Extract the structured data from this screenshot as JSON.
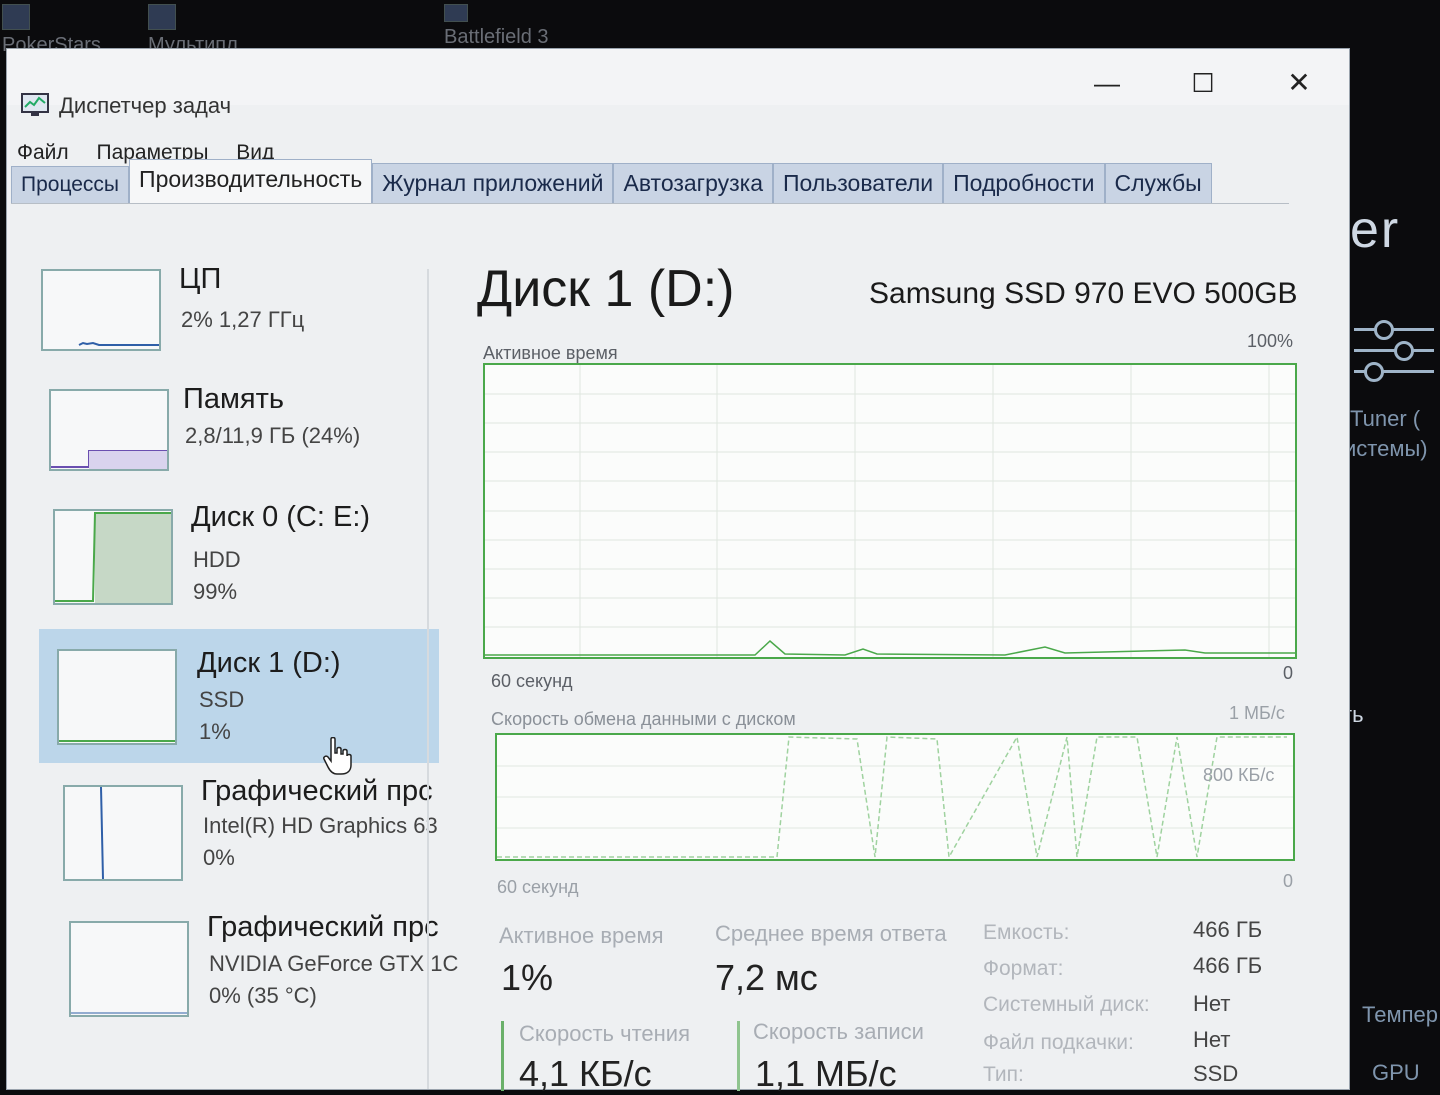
{
  "desktop": {
    "icons": [
      "PokerStars...",
      "Мультипл...",
      "Battlefield 3"
    ],
    "right_texts": [
      "Tuner (",
      "истемы)",
      "ть",
      "Темпер",
      "GPU"
    ],
    "logo": "er"
  },
  "window": {
    "title": "Диспетчер задач",
    "controls": {
      "minimize": "—",
      "maximize": "☐",
      "close": "✕"
    },
    "menu": [
      "Файл",
      "Параметры",
      "Вид"
    ],
    "tabs": [
      "Процессы",
      "Производительность",
      "Журнал приложений",
      "Автозагрузка",
      "Пользователи",
      "Подробности",
      "Службы"
    ],
    "active_tab": "Производительность"
  },
  "sidebar": {
    "items": [
      {
        "name": "ЦП",
        "line1": "2% 1,27 ГГц",
        "line2": ""
      },
      {
        "name": "Память",
        "line1": "2,8/11,9 ГБ (24%)",
        "line2": ""
      },
      {
        "name": "Диск 0 (C: E:)",
        "line1": "HDD",
        "line2": "99%"
      },
      {
        "name": "Диск 1 (D:)",
        "line1": "SSD",
        "line2": "1%"
      },
      {
        "name": "Графический прс",
        "line1": "Intel(R) HD Graphics 63",
        "line2": "0%"
      },
      {
        "name": "Графический прс",
        "line1": "NVIDIA GeForce GTX 1C",
        "line2": "0% (35 °C)"
      }
    ],
    "selected_index": 3
  },
  "detail": {
    "title": "Диск 1 (D:)",
    "model": "Samsung SSD 970 EVO 500GB",
    "graph1": {
      "label": "Активное время",
      "max": "100%",
      "time": "60 секунд",
      "min": "0"
    },
    "graph2": {
      "label": "Скорость обмена данными с диском",
      "max": "1 МБ/с",
      "mid": "800 КБ/с",
      "time": "60 секунд",
      "min": "0"
    },
    "stats": {
      "active_time_label": "Активное время",
      "active_time": "1%",
      "response_label": "Среднее время ответа",
      "response": "7,2 мс",
      "read_label": "Скорость чтения",
      "read": "4,1 КБ/с",
      "write_label": "Скорость записи",
      "write": "1,1 МБ/с"
    },
    "properties": [
      {
        "key": "Емкость:",
        "value": "466 ГБ"
      },
      {
        "key": "Формат:",
        "value": "466 ГБ"
      },
      {
        "key": "Системный диск:",
        "value": "Нет"
      },
      {
        "key": "Файл подкачки:",
        "value": "Нет"
      },
      {
        "key": "Тип:",
        "value": "SSD"
      }
    ]
  },
  "colors": {
    "graph_green": "#4aa84a",
    "selected_bg": "#bcd6ea",
    "tab_bg": "#c9d4e4"
  }
}
